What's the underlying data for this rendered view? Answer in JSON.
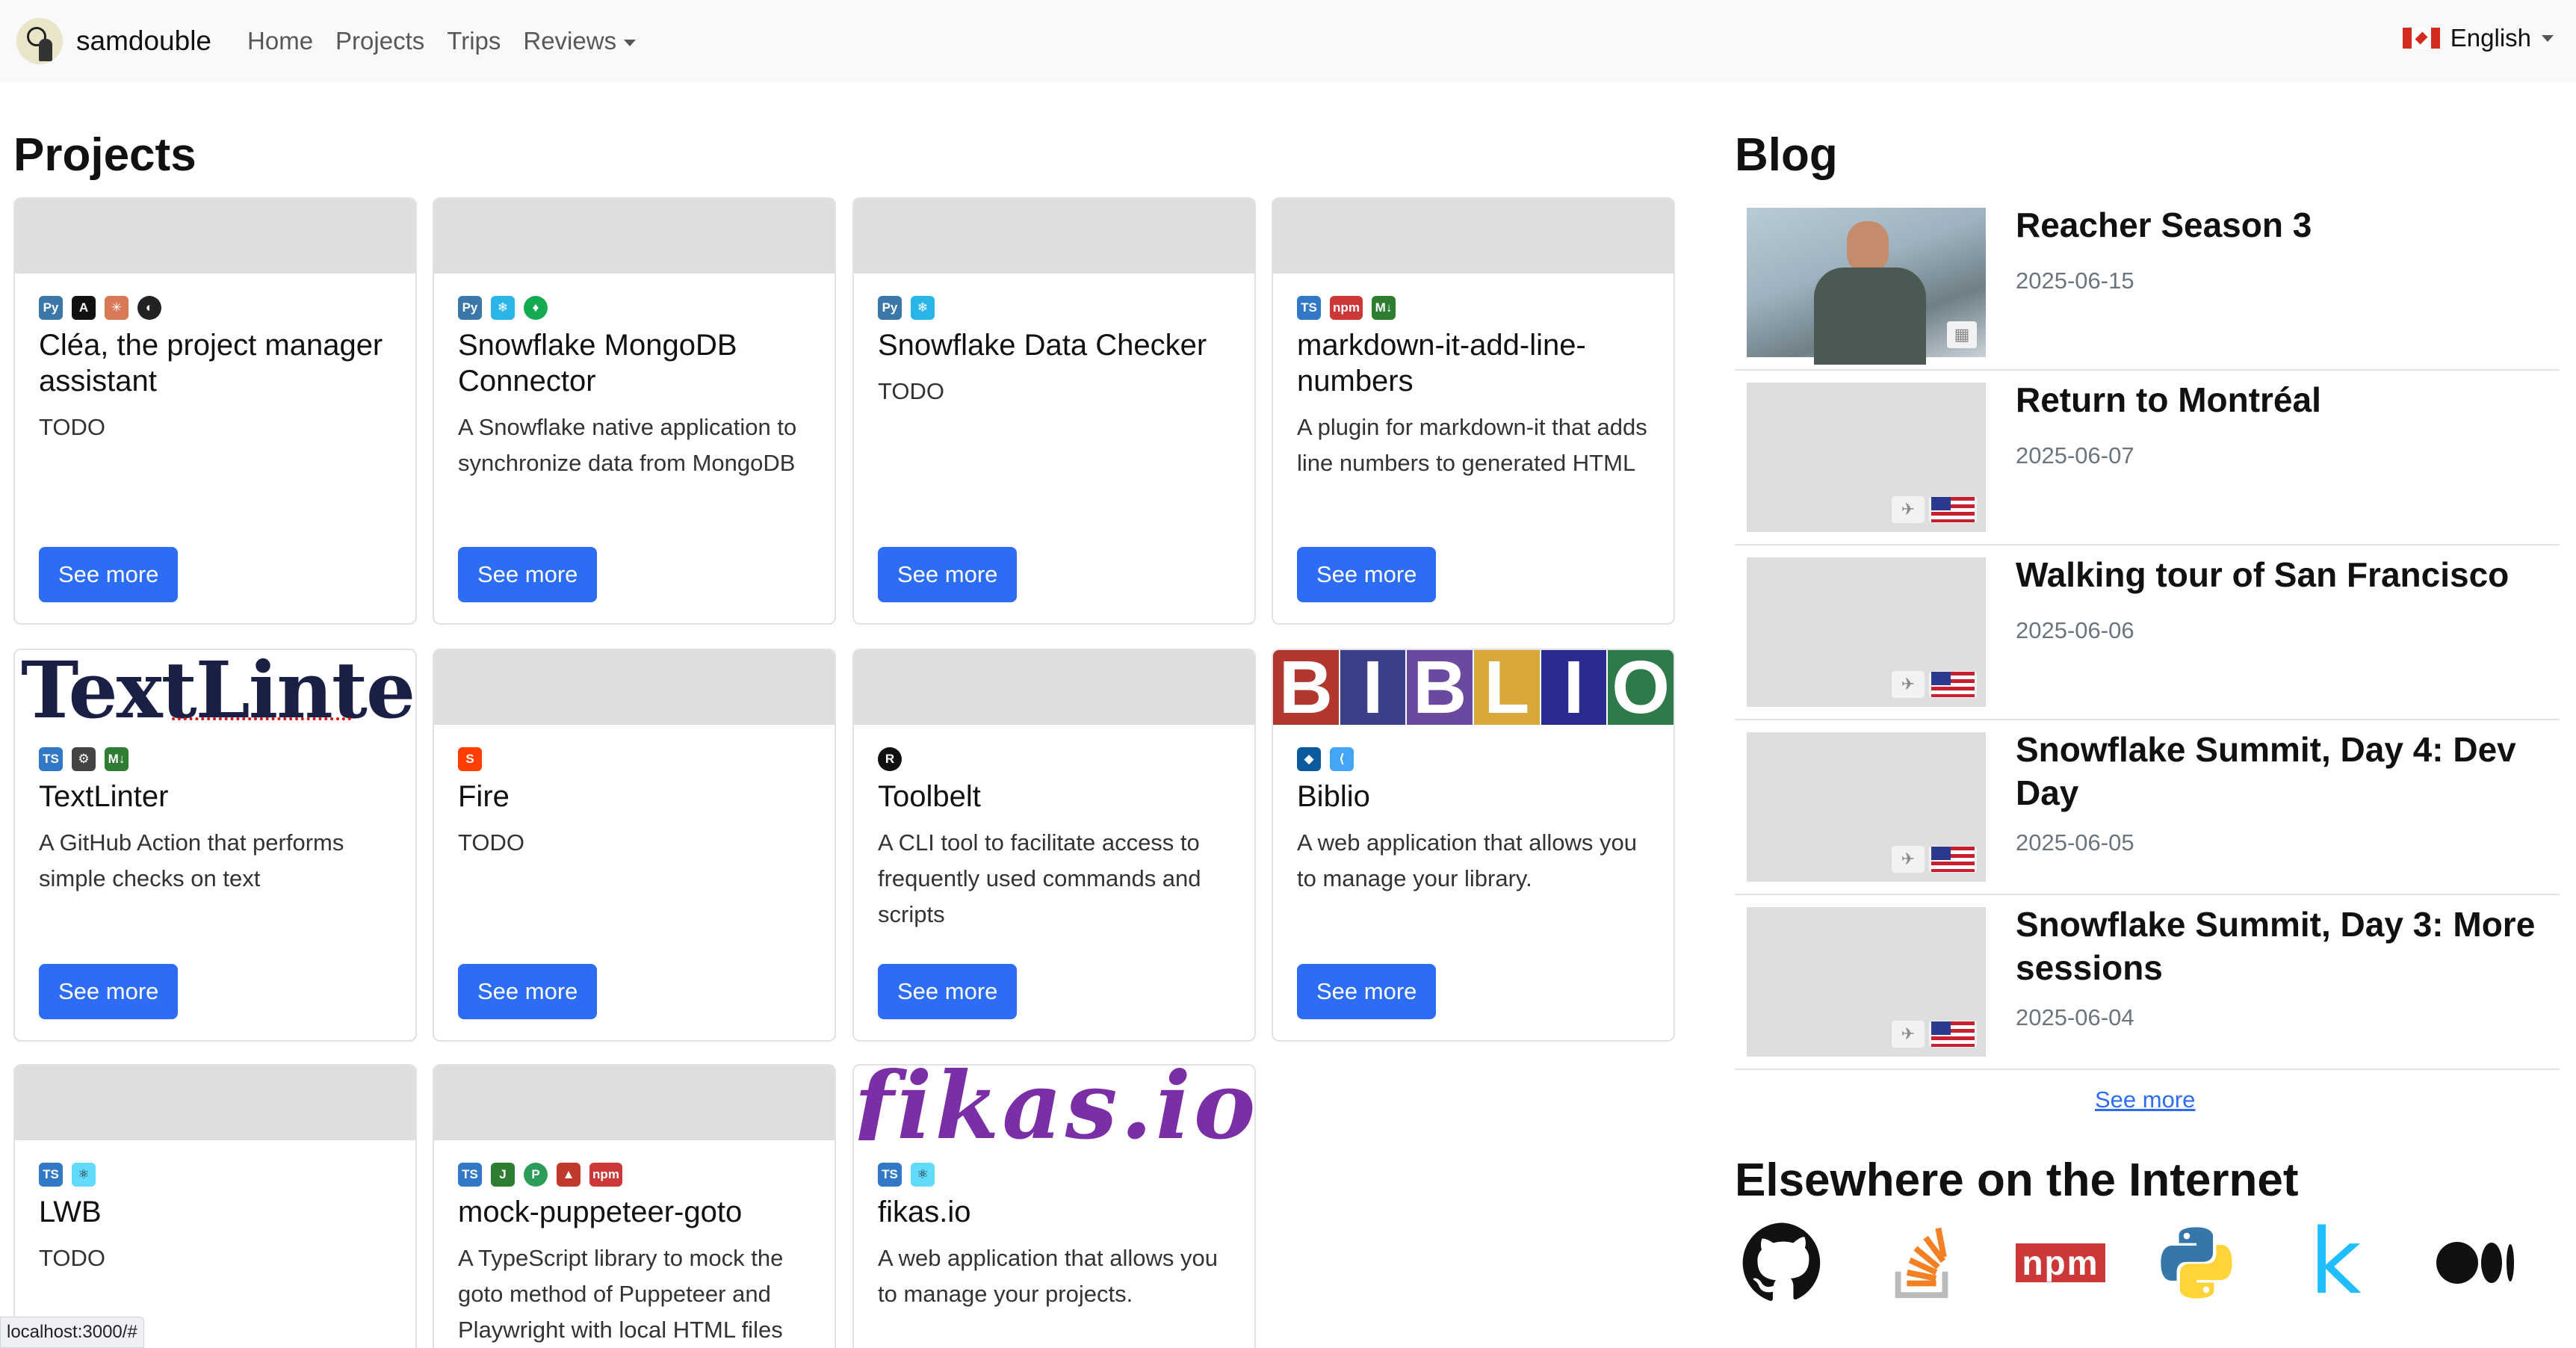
{
  "navbar": {
    "brand": "samdouble",
    "links": [
      "Home",
      "Projects",
      "Trips",
      "Reviews"
    ],
    "language": "English"
  },
  "projects": {
    "title": "Projects",
    "button_label": "See more",
    "items": [
      {
        "title": "Cléa, the project manager assistant",
        "description": "TODO"
      },
      {
        "title": "Snowflake MongoDB Connector",
        "description": "A Snowflake native application to synchronize data from MongoDB"
      },
      {
        "title": "Snowflake Data Checker",
        "description": "TODO"
      },
      {
        "title": "markdown-it-add-line-numbers",
        "description": "A plugin for markdown-it that adds line numbers to generated HTML"
      },
      {
        "title": "TextLinter",
        "description": "A GitHub Action that performs simple checks on text",
        "image_text": "TextLinter"
      },
      {
        "title": "Fire",
        "description": "TODO"
      },
      {
        "title": "Toolbelt",
        "description": "A CLI tool to facilitate access to frequently used commands and scripts"
      },
      {
        "title": "Biblio",
        "description": "A web application that allows you to manage your library.",
        "image_text": "BIBLIO"
      },
      {
        "title": "LWB",
        "description": "TODO"
      },
      {
        "title": "mock-puppeteer-goto",
        "description": "A TypeScript library to mock the goto method of Puppeteer and Playwright with local HTML files"
      },
      {
        "title": "fikas.io",
        "description": "A web application that allows you to manage your projects.",
        "image_text": "fikas.io"
      }
    ]
  },
  "blog": {
    "title": "Blog",
    "see_more": "See more",
    "items": [
      {
        "title": "Reacher Season 3",
        "date": "2025-06-15"
      },
      {
        "title": "Return to Montréal",
        "date": "2025-06-07"
      },
      {
        "title": "Walking tour of San Francisco",
        "date": "2025-06-06"
      },
      {
        "title": "Snowflake Summit, Day 4: Dev Day",
        "date": "2025-06-05"
      },
      {
        "title": "Snowflake Summit, Day 3: More sessions",
        "date": "2025-06-04"
      }
    ]
  },
  "elsewhere": {
    "title": "Elsewhere on the Internet",
    "links": [
      "github-icon",
      "stackoverflow-icon",
      "npm-icon",
      "python-icon",
      "kaggle-icon",
      "medium-icon"
    ],
    "npm_text": "npm",
    "kaggle_text": "k"
  },
  "status_bar": {
    "url": "localhost:3000/#"
  },
  "colors": {
    "primary": "#2d6df6",
    "navbar_bg": "#f8f9fa"
  }
}
